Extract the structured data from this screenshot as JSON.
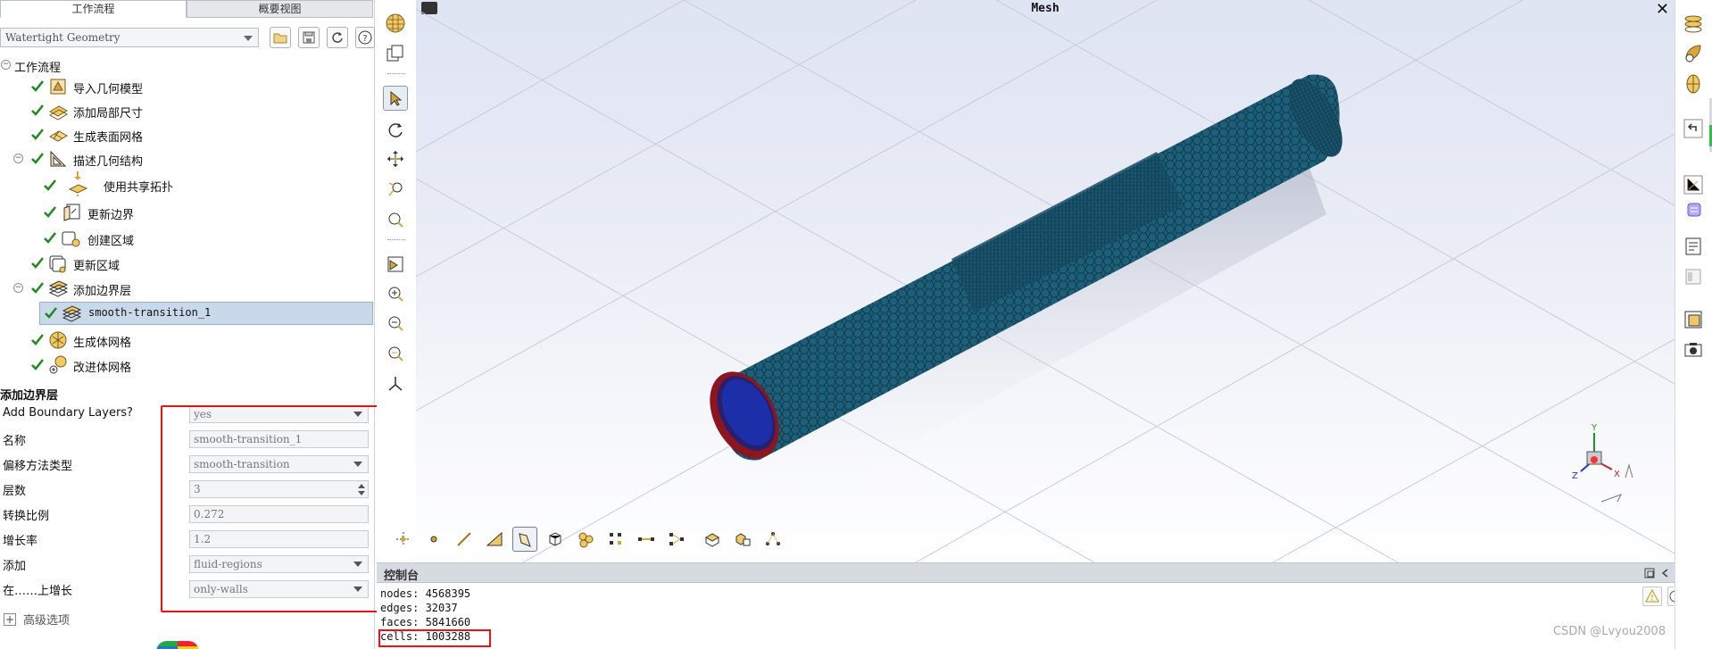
{
  "tabs": [
    "工作流程",
    "概要视图"
  ],
  "workflow_select": {
    "value": "Watertight Geometry"
  },
  "tree": {
    "root": "工作流程",
    "items": [
      {
        "label": "导入几何模型",
        "icon": "import-geometry-icon"
      },
      {
        "label": "添加局部尺寸",
        "icon": "local-sizing-icon"
      },
      {
        "label": "生成表面网格",
        "icon": "surface-mesh-icon"
      },
      {
        "label": "描述几何结构",
        "icon": "describe-geometry-icon"
      },
      {
        "label": "使用共享拓扑",
        "icon": "share-topology-icon"
      },
      {
        "label": "更新边界",
        "icon": "update-boundaries-icon"
      },
      {
        "label": "创建区域",
        "icon": "create-regions-icon"
      },
      {
        "label": "更新区域",
        "icon": "update-regions-icon"
      },
      {
        "label": "添加边界层",
        "icon": "boundary-layers-icon"
      },
      {
        "label": "smooth-transition_1",
        "icon": "boundary-layer-item-icon"
      },
      {
        "label": "生成体网格",
        "icon": "volume-mesh-icon"
      },
      {
        "label": "改进体网格",
        "icon": "improve-mesh-icon"
      }
    ]
  },
  "properties": {
    "title": "添加边界层",
    "rows": [
      {
        "label": "Add Boundary Layers?",
        "value": "yes",
        "kind": "dropdown"
      },
      {
        "label": "名称",
        "value": "smooth-transition_1",
        "kind": "text"
      },
      {
        "label": "偏移方法类型",
        "value": "smooth-transition",
        "kind": "dropdown"
      },
      {
        "label": "层数",
        "value": "3",
        "kind": "spin"
      },
      {
        "label": "转换比例",
        "value": "0.272",
        "kind": "text"
      },
      {
        "label": "增长率",
        "value": "1.2",
        "kind": "text"
      },
      {
        "label": "添加",
        "value": "fluid-regions",
        "kind": "dropdown"
      },
      {
        "label": "在……上增长",
        "value": "only-walls",
        "kind": "dropdown"
      }
    ],
    "advanced": "高级选项"
  },
  "viewport": {
    "title": "Mesh",
    "close": "✕"
  },
  "console": {
    "title": "控制台",
    "lines": [
      "nodes: 4568395",
      "edges: 32037",
      "faces: 5841660",
      "cells: 1003288"
    ]
  },
  "axis_labels": {
    "x": "X",
    "y": "Y",
    "z": "Z"
  },
  "watermark": "CSDN @Lvyou2008",
  "colors": {
    "accent_red": "#ee1111",
    "mesh": "#1f5f7a",
    "selection": "#c9d9ea"
  }
}
